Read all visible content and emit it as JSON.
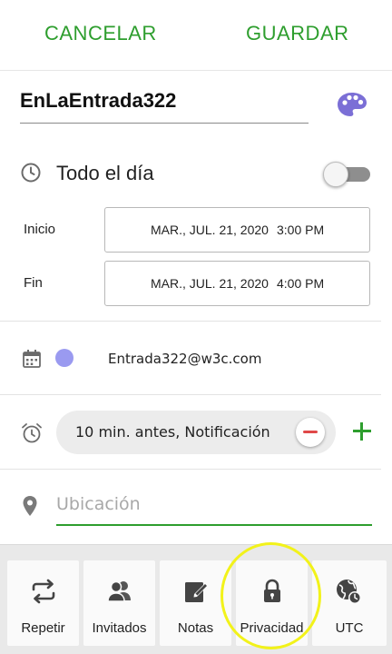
{
  "header": {
    "cancel_label": "CANCELAR",
    "save_label": "GUARDAR"
  },
  "event": {
    "title": "EnLaEntrada322",
    "all_day_label": "Todo el día",
    "all_day_enabled": false
  },
  "start": {
    "label": "Inicio",
    "date": "MAR., JUL. 21, 2020",
    "time": "3:00 PM"
  },
  "end": {
    "label": "Fin",
    "date": "MAR., JUL. 21, 2020",
    "time": "4:00 PM"
  },
  "calendar": {
    "account": "Entrada322@w3c.com",
    "color": "#9a9af0"
  },
  "reminder": {
    "text": "10 min. antes, Notificación"
  },
  "location": {
    "placeholder": "Ubicación",
    "value": ""
  },
  "bottom_tabs": [
    {
      "label": "Repetir",
      "icon": "repeat-icon"
    },
    {
      "label": "Invitados",
      "icon": "guests-icon"
    },
    {
      "label": "Notas",
      "icon": "notes-icon"
    },
    {
      "label": "Privacidad",
      "icon": "lock-icon"
    },
    {
      "label": "UTC",
      "icon": "globe-clock-icon"
    }
  ],
  "colors": {
    "accent": "#2e9e2e",
    "remove": "#e04848",
    "highlight": "#f2f21a"
  }
}
